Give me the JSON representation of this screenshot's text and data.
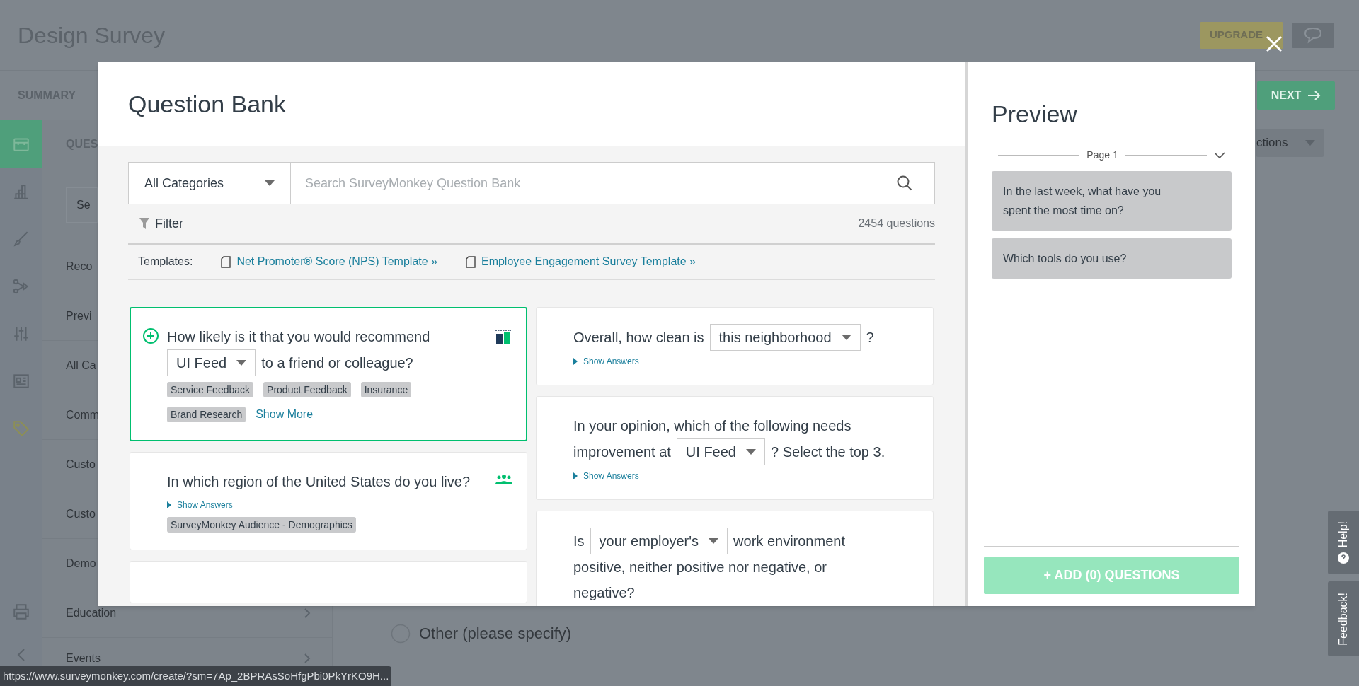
{
  "background": {
    "title": "Design Survey",
    "nav_tab": "SUMMARY",
    "upgrade_button": "UPGRADE",
    "next_button": "NEXT",
    "panel_heading": "QUES",
    "search_placeholder": "Se",
    "sidebar_icons": [
      {
        "kind": "store",
        "selected": true
      },
      {
        "kind": "chart",
        "selected": false
      },
      {
        "kind": "brush",
        "selected": false
      },
      {
        "kind": "branch",
        "selected": false
      },
      {
        "kind": "sliders",
        "selected": false
      },
      {
        "kind": "layout",
        "selected": false
      },
      {
        "kind": "tag",
        "selected": false
      }
    ],
    "list_items": [
      {
        "label": "Reco"
      },
      {
        "label": "Previ"
      },
      {
        "label": "All Ca"
      },
      {
        "label": "Comm"
      },
      {
        "label": "Custo"
      },
      {
        "label": "Custo"
      },
      {
        "label": "Demo"
      },
      {
        "label": "Education",
        "chevron": true
      },
      {
        "label": "Events",
        "chevron": true
      }
    ],
    "actions_button": "ctions",
    "option": "Other (please specify)",
    "help_tab": "Help!",
    "feedback_tab": "Feedback!",
    "status_url": "https://www.surveymonkey.com/create/?sm=7Ap_2BPRAsSoHfgPbi0PkYrKO9H..."
  },
  "question_bank": {
    "title": "Question Bank",
    "category": "All Categories",
    "search_placeholder": "Search SurveyMonkey Question Bank",
    "filter": "Filter",
    "count": "2454 questions",
    "templates_label": "Templates:",
    "templates": [
      "Net Promoter® Score (NPS) Template »",
      "Employee Engagement Survey Template »"
    ],
    "columns": [
      [
        {
          "selected": true,
          "kind": "benchmark",
          "parts": [
            {
              "kind": "text",
              "text": "How likely is it that you would recommend"
            },
            {
              "kind": "select",
              "text": "UI Feed"
            },
            {
              "kind": "text",
              "text": "to a friend or colleague?"
            }
          ],
          "tags": [
            "Service Feedback",
            "Product Feedback",
            "Insurance",
            "Brand Research"
          ],
          "show_more": "Show More"
        },
        {
          "selected": false,
          "kind": "audience",
          "parts": [
            {
              "kind": "text",
              "text": "In which region of the United States do you live?"
            }
          ],
          "show_answers": "Show Answers",
          "tags": [
            "SurveyMonkey Audience - Demographics"
          ]
        }
      ],
      [
        {
          "selected": false,
          "parts": [
            {
              "kind": "text",
              "text": "Overall, how clean is"
            },
            {
              "kind": "select",
              "text": "this neighborhood"
            },
            {
              "kind": "text",
              "text": "?"
            }
          ],
          "show_answers": "Show Answers"
        },
        {
          "selected": false,
          "parts": [
            {
              "kind": "text",
              "text": "In your opinion, which of the following needs"
            },
            {
              "kind": "text",
              "text": "improvement at"
            },
            {
              "kind": "select",
              "text": "UI Feed"
            },
            {
              "kind": "text",
              "text": "? Select the top 3."
            }
          ],
          "show_answers": "Show Answers"
        },
        {
          "selected": false,
          "parts": [
            {
              "kind": "text",
              "text": "Is"
            },
            {
              "kind": "select",
              "text": "your employer's"
            },
            {
              "kind": "text",
              "text": "work environment"
            },
            {
              "kind": "text",
              "text": "positive, neither positive nor negative, or"
            },
            {
              "kind": "text",
              "text": "negative?"
            }
          ]
        }
      ]
    ]
  },
  "preview": {
    "title": "Preview",
    "page_label": "Page 1",
    "questions": [
      "In the last week, what have you spent the most time on?",
      "Which tools do you use?"
    ],
    "add_button": "+ ADD (0) QUESTIONS"
  }
}
